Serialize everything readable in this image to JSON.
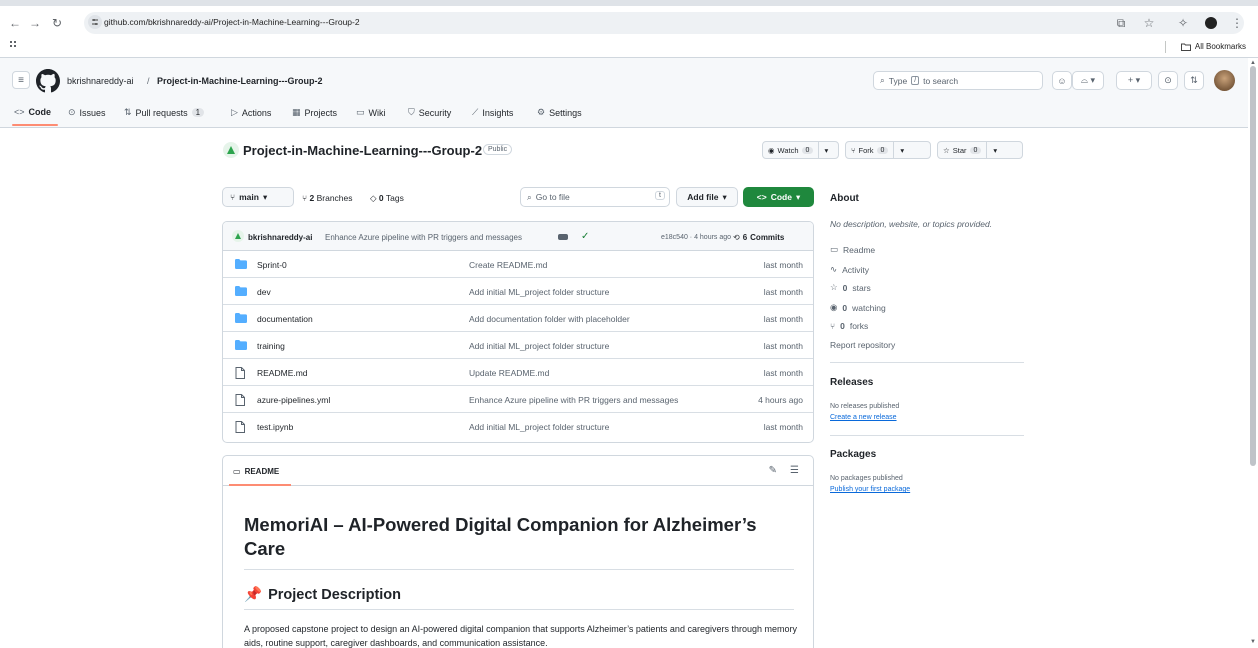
{
  "browser": {
    "url": "github.com/bkrishnareddy-ai/Project-in-Machine-Learning---Group-2",
    "all_bookmarks": "All Bookmarks"
  },
  "header": {
    "owner": "bkrishnareddy-ai",
    "separator": "/",
    "repo": "Project-in-Machine-Learning---Group-2",
    "search_prefix": "Type",
    "search_key": "/",
    "search_suffix": "to search"
  },
  "tabs": [
    {
      "label": "Code",
      "icon": "code-icon"
    },
    {
      "label": "Issues",
      "icon": "issue-icon"
    },
    {
      "label": "Pull requests",
      "icon": "pull-request-icon",
      "count": "1"
    },
    {
      "label": "Actions",
      "icon": "play-icon"
    },
    {
      "label": "Projects",
      "icon": "table-icon"
    },
    {
      "label": "Wiki",
      "icon": "book-icon"
    },
    {
      "label": "Security",
      "icon": "shield-icon"
    },
    {
      "label": "Insights",
      "icon": "graph-icon"
    },
    {
      "label": "Settings",
      "icon": "gear-icon"
    }
  ],
  "repo": {
    "title": "Project-in-Machine-Learning---Group-2",
    "visibility": "Public",
    "watch_label": "Watch",
    "watch_count": "0",
    "fork_label": "Fork",
    "fork_count": "0",
    "star_label": "Star",
    "star_count": "0"
  },
  "toolbar": {
    "branch": "main",
    "branches_count": "2",
    "branches_label": "Branches",
    "tags_count": "0",
    "tags_label": "Tags",
    "goto_placeholder": "Go to file",
    "goto_key": "t",
    "add_file": "Add file",
    "code": "Code"
  },
  "commit": {
    "author": "bkrishnareddy-ai",
    "message": "Enhance Azure pipeline with PR triggers and messages",
    "meta": "e18c540 · 4 hours ago",
    "commits_count": "6",
    "commits_label": "Commits"
  },
  "files": [
    {
      "type": "folder",
      "name": "Sprint-0",
      "message": "Create README.md",
      "date": "last month"
    },
    {
      "type": "folder",
      "name": "dev",
      "message": "Add initial ML_project folder structure",
      "date": "last month"
    },
    {
      "type": "folder",
      "name": "documentation",
      "message": "Add documentation folder with placeholder",
      "date": "last month"
    },
    {
      "type": "folder",
      "name": "training",
      "message": "Add initial ML_project folder structure",
      "date": "last month"
    },
    {
      "type": "file",
      "name": "README.md",
      "message": "Update README.md",
      "date": "last month"
    },
    {
      "type": "file",
      "name": "azure-pipelines.yml",
      "message": "Enhance Azure pipeline with PR triggers and messages",
      "date": "4 hours ago"
    },
    {
      "type": "file",
      "name": "test.ipynb",
      "message": "Add initial ML_project folder structure",
      "date": "last month"
    }
  ],
  "readme": {
    "tab": "README",
    "h1": "MemoriAI – AI-Powered Digital Companion for Alzheimer’s Care",
    "h2": "Project Description",
    "paragraph": "A proposed capstone project to design an AI-powered digital companion that supports Alzheimer’s patients and caregivers through memory aids, routine support, caregiver dashboards, and communication assistance."
  },
  "sidebar": {
    "about": "About",
    "description": "No description, website, or topics provided.",
    "readme": "Readme",
    "activity": "Activity",
    "stars_count": "0",
    "stars_label": "stars",
    "watching_count": "0",
    "watching_label": "watching",
    "forks_count": "0",
    "forks_label": "forks",
    "report": "Report repository",
    "releases": "Releases",
    "no_releases": "No releases published",
    "create_release": "Create a new release",
    "packages": "Packages",
    "no_packages": "No packages published",
    "publish_package": "Publish your first package"
  },
  "colors": {
    "green_button": "#1f883d",
    "link": "#0969da",
    "tab_underline": "#fd8c73",
    "folder": "#54aeff"
  }
}
